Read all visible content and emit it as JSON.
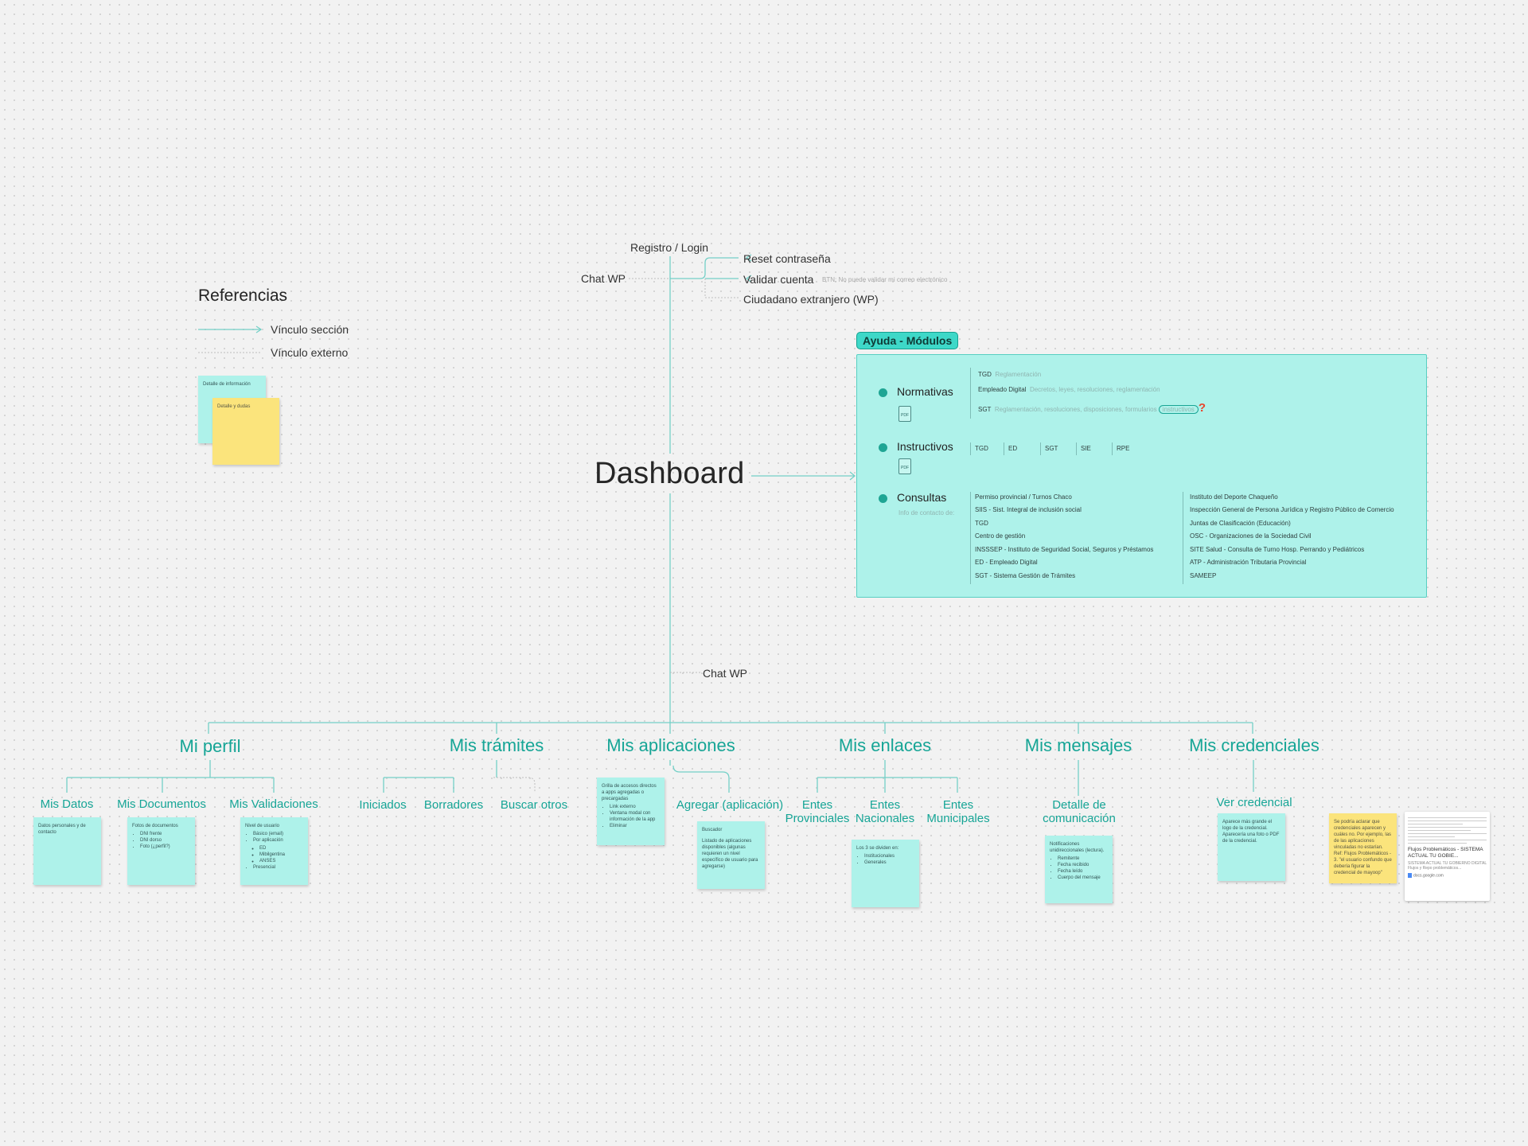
{
  "references": {
    "title": "Referencias",
    "section_link": "Vínculo sección",
    "external_link": "Vínculo externo",
    "note_info": "Detalle de información",
    "note_doubts": "Detalle y dudas"
  },
  "top": {
    "registro": "Registro / Login",
    "chat_wp": "Chat WP",
    "reset": "Reset contraseña",
    "validar": "Validar cuenta",
    "validar_note": "BTN: No puede validar mi correo electrónico",
    "extranjero": "Ciudadano extranjero (WP)"
  },
  "dashboard": "Dashboard",
  "chat_wp_mid": "Chat WP",
  "ayuda": {
    "tag": "Ayuda - Módulos",
    "normativas": {
      "title": "Normativas",
      "pdf": "PDF",
      "rows": [
        {
          "key": "TGD",
          "desc": "Reglamentación"
        },
        {
          "key": "Empleado Digital",
          "desc": "Decretos, leyes, resoluciones, reglamentación"
        },
        {
          "key": "SGT",
          "desc": "Reglamentación, resoluciones, disposiciones, formularios",
          "circled": "instructivos",
          "mark": "?"
        }
      ]
    },
    "instructivos": {
      "title": "Instructivos",
      "pdf": "PDF",
      "items": [
        "TGD",
        "ED",
        "SGT",
        "SIE",
        "RPE"
      ]
    },
    "consultas": {
      "title": "Consultas",
      "sub": "Info de contacto de:",
      "col1": [
        "Permiso provincial / Turnos Chaco",
        "SIIS - Sist. Integral de inclusión social",
        "TGD",
        "Centro de gestión",
        "INSSSEP - Instituto de Seguridad Social, Seguros y Préstamos",
        "ED - Empleado Digital",
        "SGT - Sistema Gestión de Trámites"
      ],
      "col2": [
        "Instituto del Deporte Chaqueño",
        "Inspección General de Persona Jurídica y Registro Público de Comercio",
        "Juntas de Clasificación (Educación)",
        "OSC - Organizaciones de la Sociedad Civil",
        "SITE Salud - Consulta de Turno Hosp. Perrando y Pediátricos",
        "ATP - Administración Tributaria Provincial",
        "SAMEEP"
      ]
    }
  },
  "sections": {
    "perfil": {
      "title": "Mi perfil",
      "datos": "Mis Datos",
      "documentos": "Mis Documentos",
      "validaciones": "Mis Validaciones",
      "note_datos": "Datos personales y de contacto",
      "note_docs_title": "Fotos de documentos",
      "note_docs_items": [
        "DNI frente",
        "DNI dorso",
        "Foto (¿perfil?)"
      ],
      "note_val_title": "Nivel de usuario",
      "note_val_items": [
        "Básico (email)",
        "Por aplicación"
      ],
      "note_val_sub": [
        "ED",
        "Mibilgentina",
        "ANSES"
      ],
      "note_val_last": "Presencial"
    },
    "tramites": {
      "title": "Mis trámites",
      "iniciados": "Iniciados",
      "borradores": "Borradores",
      "buscar": "Buscar otros"
    },
    "aplicaciones": {
      "title": "Mis aplicaciones",
      "agregar": "Agregar (aplicación)",
      "note_grid": "Grilla de accesos directos a apps agregadas o precargadas",
      "note_grid_items": [
        "Link externo",
        "Ventana modal con información de la app",
        "Eliminar"
      ],
      "note_search_title": "Buscador",
      "note_search": "Listado de aplicaciones disponibles (algunas requieren un nivel específico de usuario para agregarse)"
    },
    "enlaces": {
      "title": "Mis enlaces",
      "provinciales": "Entes Provinciales",
      "nacionales": "Entes Nacionales",
      "municipales": "Entes Municipales",
      "note": "Los 3 se dividen en:",
      "note_items": [
        "Institucionales",
        "Generales"
      ]
    },
    "mensajes": {
      "title": "Mis mensajes",
      "detalle": "Detalle de comunicación",
      "note": "Notificaciones unidireccionales (lectura).",
      "note_items": [
        "Remitente",
        "Fecha recibido",
        "Fecha leído",
        "Cuerpo del mensaje"
      ]
    },
    "credenciales": {
      "title": "Mis credenciales",
      "ver": "Ver credencial",
      "note": "Aparece más grande el logo de la credencial. Aparecería una foto o PDF de la credencial.",
      "note_yellow": "Se podría aclarar que credenciales aparecen y cuáles no. Por ejemplo, las de las aplicaciones vinculadas no estarían. Ref: Flujos Problemáticos - 3. \"el usuario confundo que debería figurar la credencial de mayoop\"",
      "doc_title": "Flujos Problemáticos - SISTEMA ACTUAL TU GOBIE...",
      "doc_sub": "SISTEMA ACTUAL TU GOBIERNO DIGITAL Flujos y Repo problemáticos...",
      "doc_src": "docs.google.com"
    }
  },
  "colors": {
    "teal_line": "#6dcdc4",
    "teal_text": "#16a596",
    "note": "#aef2ea",
    "note_yellow": "#fbe47c"
  }
}
